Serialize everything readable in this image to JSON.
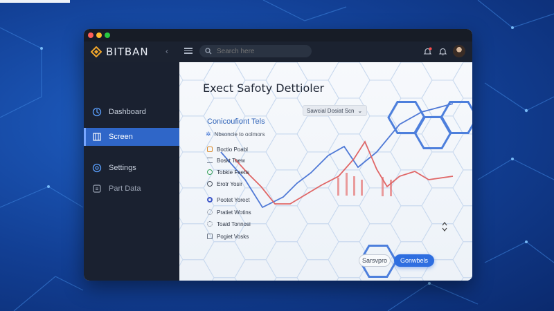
{
  "app": {
    "brand_name": "BITBAN",
    "brand_color": "#f2a72b",
    "accent_color": "#2f66c8"
  },
  "topbar": {
    "search_placeholder": "Search here",
    "icons": [
      "collapse-icon",
      "menu-icon",
      "search-icon",
      "alert-bell-icon",
      "bell-icon",
      "avatar"
    ]
  },
  "sidebar": {
    "items": [
      {
        "label": "Dashboard",
        "icon": "dashboard-icon",
        "active": false
      },
      {
        "label": "Screen",
        "icon": "screen-icon",
        "active": true
      },
      {
        "label": "Settings",
        "icon": "settings-icon",
        "active": false
      },
      {
        "label": "Part Data",
        "icon": "part-data-icon",
        "active": false
      }
    ]
  },
  "main": {
    "title": "Exect Safoty Dettioler",
    "dropdown_value": "Sawcial Dosiat  Scn",
    "section_title": "Conicoufiont Tels",
    "subheader": "Nbsoncie to oolmors",
    "list": [
      {
        "label": "Boctio Poabl",
        "icon": "lock-icon",
        "color": "#d98a2a"
      },
      {
        "label": "Boskt Toew",
        "icon": "list-icon",
        "color": "#6d7787"
      },
      {
        "label": "Tobkie Feetis",
        "icon": "check-circle-icon",
        "color": "#3aa35d"
      },
      {
        "label": "Erotr Yosir",
        "icon": "check-circle-icon",
        "color": "#4a5260"
      },
      {
        "label": "Pootet Yorect",
        "icon": "radio-icon",
        "color": "#3d55c8"
      },
      {
        "label": "Pratiet Wotins",
        "icon": "gear-icon",
        "color": "#6d7787"
      },
      {
        "label": "Toaid Tonnosi",
        "icon": "gear-icon",
        "color": "#6d7787"
      },
      {
        "label": "Pogiet Vosks",
        "icon": "image-icon",
        "color": "#6d7787"
      }
    ],
    "buttons": {
      "secondary": "Sarsvpro",
      "primary": "Gonwbels"
    }
  }
}
